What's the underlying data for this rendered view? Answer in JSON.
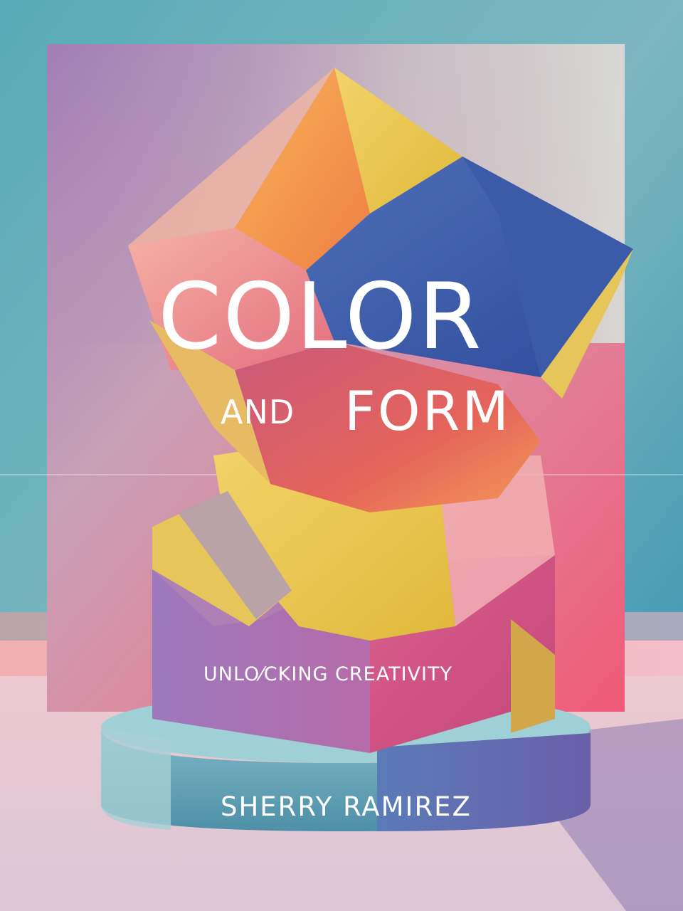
{
  "cover": {
    "title_main": "COLOR",
    "title_and": "AND",
    "title_form": "FORM",
    "subtitle": "UNLO⁄CKING CREATIVITY",
    "author": "SHERRY  RAMIREZ"
  }
}
